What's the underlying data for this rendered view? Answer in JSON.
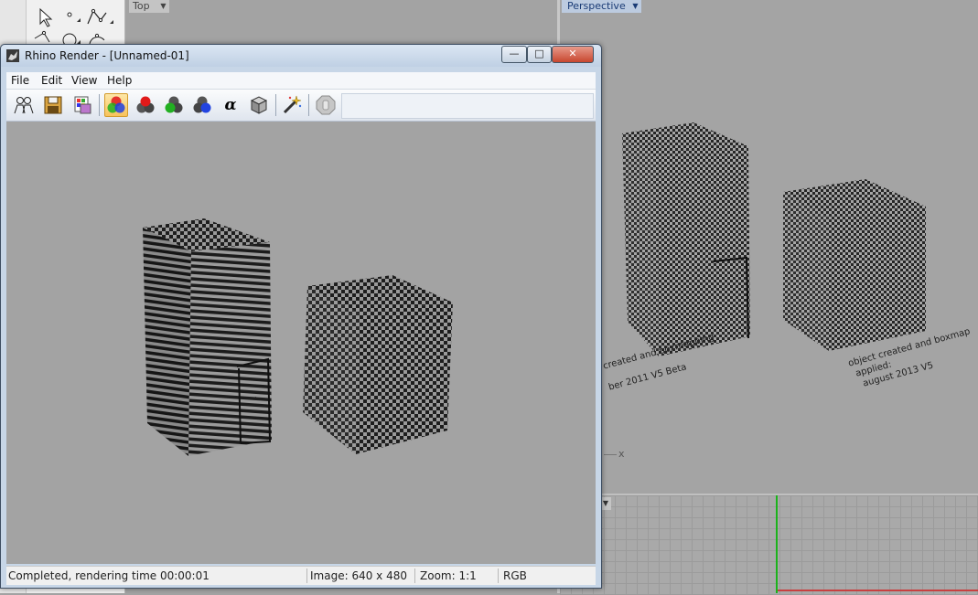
{
  "background_app": {
    "top_viewport": {
      "label": "Top"
    },
    "perspective_viewport": {
      "label": "Perspective",
      "annotation_left": [
        "created and boxmapping",
        "ber 2011 V5 Beta"
      ],
      "annotation_right": [
        "object created and boxmap",
        "applied:",
        "august 2013 V5"
      ],
      "axis_label": "x"
    }
  },
  "render_window": {
    "title": "Rhino Render - [Unnamed-01]",
    "caption_buttons": {
      "minimize": "—",
      "maximize": "□",
      "close": "✕"
    },
    "menu": [
      "File",
      "Edit",
      "View",
      "Help"
    ],
    "toolbar_icons": [
      "people-icon",
      "save-icon",
      "palette-icon",
      "rgb-channels-icon",
      "red-channel-icon",
      "green-channel-icon",
      "blue-channel-icon",
      "alpha-channel-icon",
      "grey-cube-icon",
      "magic-wand-icon",
      "stop-render-icon"
    ],
    "alpha_glyph": "α",
    "status": {
      "message": "Completed, rendering time 00:00:01",
      "image_size": "Image: 640 x 480",
      "zoom": "Zoom: 1:1",
      "channel": "RGB"
    }
  },
  "colors": {
    "viewport_bg": "#a3a3a3",
    "titlebar": "#c7d6e7",
    "active_tool": "#f8c35b",
    "perspective_tab": "#bccbe0"
  }
}
